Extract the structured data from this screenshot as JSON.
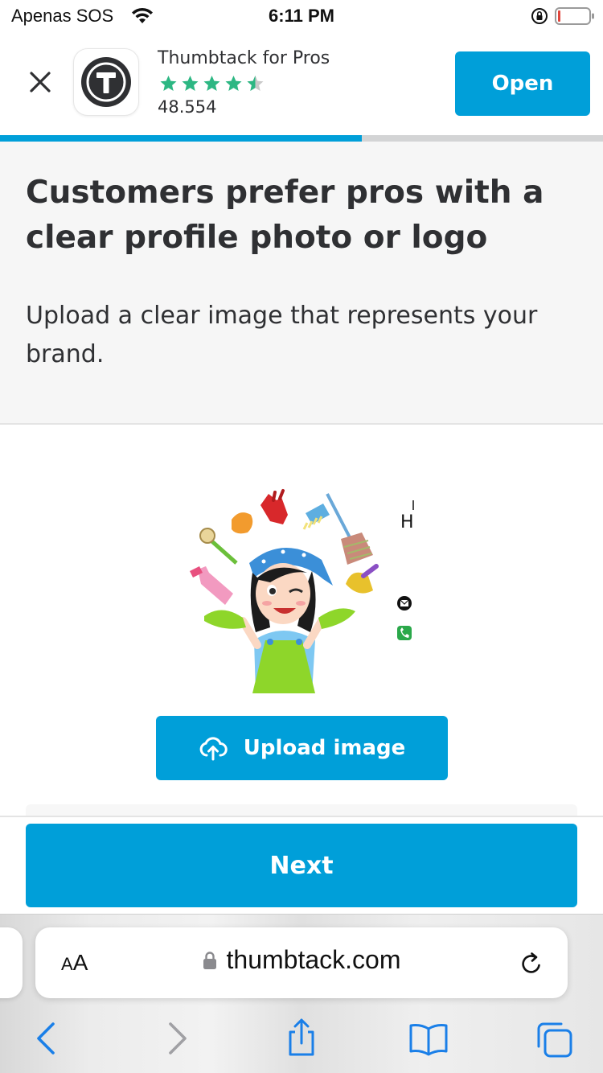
{
  "status_bar": {
    "carrier": "Apenas SOS",
    "time": "6:11 PM",
    "wifi_icon": "wifi-icon",
    "lock_icon": "orientation-lock-icon",
    "battery_icon": "battery-icon"
  },
  "app_banner": {
    "close_icon": "close-icon",
    "app_name": "Thumbtack for Pros",
    "rating_stars": 4.5,
    "rating_count": "48.554",
    "open_label": "Open"
  },
  "progress": {
    "fraction": 0.6
  },
  "content": {
    "headline": "Customers prefer pros with a clear profile photo or logo",
    "subtext": "Upload a clear image that represents your brand.",
    "image_text": "H",
    "upload_label": "Upload image"
  },
  "footer": {
    "next_label": "Next"
  },
  "browser": {
    "aa_label_small": "A",
    "aa_label_large": "A",
    "url": "thumbtack.com",
    "icons": [
      "back-icon",
      "forward-icon",
      "share-icon",
      "bookmarks-icon",
      "tabs-icon"
    ]
  },
  "colors": {
    "accent": "#009fd9",
    "star": "#2db783",
    "text": "#2f3033"
  }
}
